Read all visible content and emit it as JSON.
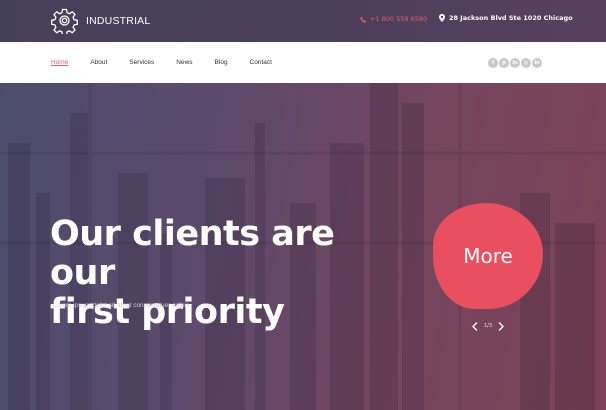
{
  "header": {
    "brand": "INDUSTRIAL",
    "phone": "+1 800 559 6580",
    "address": "28 Jackson Blvd Ste 1020 Chicago"
  },
  "nav": {
    "items": [
      {
        "label": "Home",
        "active": true
      },
      {
        "label": "About",
        "active": false
      },
      {
        "label": "Services",
        "active": false
      },
      {
        "label": "News",
        "active": false
      },
      {
        "label": "Blog",
        "active": false
      },
      {
        "label": "Contact",
        "active": false
      }
    ]
  },
  "social": {
    "icons": [
      "facebook-icon",
      "pinterest-icon",
      "linkedin-icon",
      "dribbble-icon",
      "linkedin-alt-icon"
    ],
    "glyphs": [
      "f",
      "p",
      "in",
      "◎",
      "in"
    ]
  },
  "hero": {
    "headline_line1": "Our clients are our",
    "headline_line2": "first priority",
    "subtext": "Lorem ipsum dolor sit amet consectetuer adipis",
    "button_label": "More",
    "slide_counter": "1/3"
  },
  "colors": {
    "accent": "#e94f5f",
    "topbar": "#4a3f5c",
    "nav_bg": "#ffffff"
  }
}
